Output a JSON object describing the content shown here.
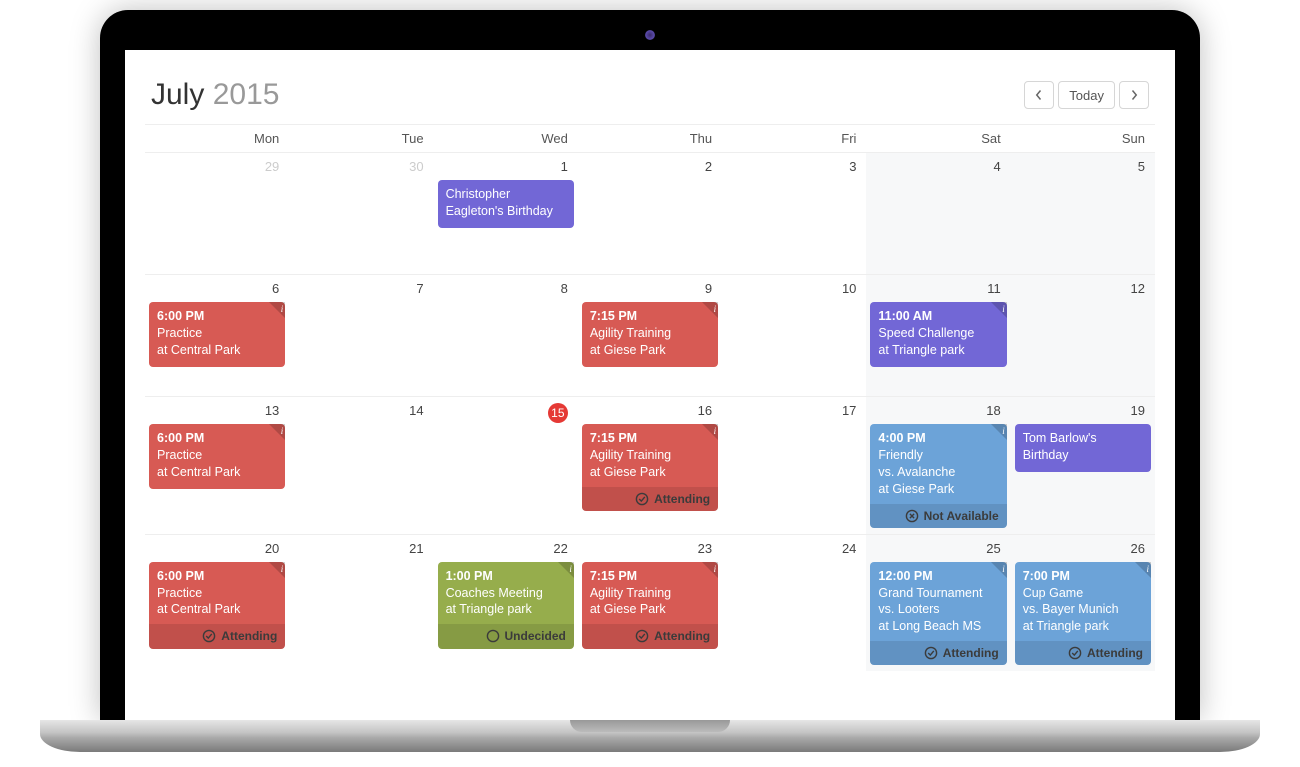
{
  "header": {
    "month": "July",
    "year": "2015",
    "today_label": "Today"
  },
  "day_names": [
    "Mon",
    "Tue",
    "Wed",
    "Thu",
    "Fri",
    "Sat",
    "Sun"
  ],
  "colors": {
    "red": "#d75a54",
    "purple": "#7267d6",
    "green": "#96ad4c",
    "blue": "#6ca3d8",
    "today_badge": "#e53935"
  },
  "status_labels": {
    "attending": "Attending",
    "undecided": "Undecided",
    "not_available": "Not Available"
  },
  "weeks": [
    {
      "days": [
        {
          "num": "29",
          "other_month": true,
          "weekend": false,
          "events": []
        },
        {
          "num": "30",
          "other_month": true,
          "weekend": false,
          "events": []
        },
        {
          "num": "1",
          "other_month": false,
          "weekend": false,
          "events": [
            {
              "color": "purple",
              "corner": false,
              "lines": [
                "Christopher Eagleton's Birthday"
              ]
            }
          ]
        },
        {
          "num": "2",
          "other_month": false,
          "weekend": false,
          "events": []
        },
        {
          "num": "3",
          "other_month": false,
          "weekend": false,
          "events": []
        },
        {
          "num": "4",
          "other_month": false,
          "weekend": true,
          "events": []
        },
        {
          "num": "5",
          "other_month": false,
          "weekend": true,
          "events": []
        }
      ]
    },
    {
      "days": [
        {
          "num": "6",
          "weekend": false,
          "events": [
            {
              "color": "red",
              "corner": true,
              "time": "6:00 PM",
              "lines": [
                "Practice",
                "at Central Park"
              ]
            }
          ]
        },
        {
          "num": "7",
          "weekend": false,
          "events": []
        },
        {
          "num": "8",
          "weekend": false,
          "events": []
        },
        {
          "num": "9",
          "weekend": false,
          "events": [
            {
              "color": "red",
              "corner": true,
              "time": "7:15 PM",
              "lines": [
                "Agility Training",
                "at Giese Park"
              ]
            }
          ]
        },
        {
          "num": "10",
          "weekend": false,
          "events": []
        },
        {
          "num": "11",
          "weekend": true,
          "events": [
            {
              "color": "purple",
              "corner": true,
              "time": "11:00 AM",
              "lines": [
                "Speed Challenge",
                "at Triangle park"
              ]
            }
          ]
        },
        {
          "num": "12",
          "weekend": true,
          "events": []
        }
      ]
    },
    {
      "days": [
        {
          "num": "13",
          "weekend": false,
          "events": [
            {
              "color": "red",
              "corner": true,
              "time": "6:00 PM",
              "lines": [
                "Practice",
                "at Central Park"
              ]
            }
          ]
        },
        {
          "num": "14",
          "weekend": false,
          "events": []
        },
        {
          "num": "15",
          "weekend": false,
          "today": true,
          "events": []
        },
        {
          "num": "16",
          "weekend": false,
          "events": [
            {
              "color": "red",
              "corner": true,
              "time": "7:15 PM",
              "lines": [
                "Agility Training",
                "at Giese Park"
              ],
              "status": "attending"
            }
          ]
        },
        {
          "num": "17",
          "weekend": false,
          "events": []
        },
        {
          "num": "18",
          "weekend": true,
          "events": [
            {
              "color": "blue",
              "corner": true,
              "time": "4:00 PM",
              "lines": [
                "Friendly",
                "vs. Avalanche",
                "at Giese Park"
              ],
              "status": "not_available"
            }
          ]
        },
        {
          "num": "19",
          "weekend": true,
          "events": [
            {
              "color": "purple",
              "corner": false,
              "lines": [
                "Tom Barlow's Birthday"
              ]
            }
          ]
        }
      ]
    },
    {
      "days": [
        {
          "num": "20",
          "weekend": false,
          "events": [
            {
              "color": "red",
              "corner": true,
              "time": "6:00 PM",
              "lines": [
                "Practice",
                "at Central Park"
              ],
              "status": "attending"
            }
          ]
        },
        {
          "num": "21",
          "weekend": false,
          "events": []
        },
        {
          "num": "22",
          "weekend": false,
          "events": [
            {
              "color": "green",
              "corner": true,
              "time": "1:00 PM",
              "lines": [
                "Coaches Meeting",
                "at Triangle park"
              ],
              "status": "undecided"
            }
          ]
        },
        {
          "num": "23",
          "weekend": false,
          "events": [
            {
              "color": "red",
              "corner": true,
              "time": "7:15 PM",
              "lines": [
                "Agility Training",
                "at Giese Park"
              ],
              "status": "attending"
            }
          ]
        },
        {
          "num": "24",
          "weekend": false,
          "events": []
        },
        {
          "num": "25",
          "weekend": true,
          "events": [
            {
              "color": "blue",
              "corner": true,
              "time": "12:00 PM",
              "lines": [
                "Grand Tournament",
                "vs. Looters",
                "at Long Beach MS"
              ],
              "status": "attending"
            }
          ]
        },
        {
          "num": "26",
          "weekend": true,
          "events": [
            {
              "color": "blue",
              "corner": true,
              "time": "7:00 PM",
              "lines": [
                "Cup Game",
                "vs. Bayer Munich",
                "at Triangle park"
              ],
              "status": "attending"
            }
          ]
        }
      ]
    }
  ]
}
